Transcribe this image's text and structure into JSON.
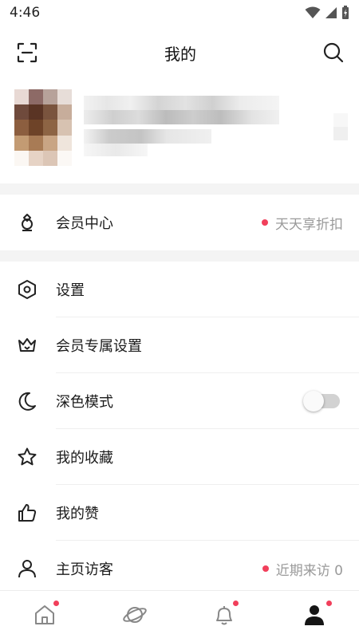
{
  "status_bar": {
    "time": "4:46"
  },
  "header": {
    "title": "我的"
  },
  "member_row": {
    "label": "会员中心",
    "badge_text": "天天享折扣"
  },
  "menu": [
    {
      "icon": "hexagon-settings-icon",
      "label": "设置"
    },
    {
      "icon": "crown-icon",
      "label": "会员专属设置"
    },
    {
      "icon": "moon-icon",
      "label": "深色模式",
      "toggle_on": false
    },
    {
      "icon": "star-icon",
      "label": "我的收藏"
    },
    {
      "icon": "thumbs-up-icon",
      "label": "我的赞"
    },
    {
      "icon": "person-icon",
      "label": "主页访客",
      "badge_text": "近期来访 0"
    }
  ],
  "bottom_nav": [
    {
      "icon": "home-icon",
      "has_dot": true
    },
    {
      "icon": "planet-icon",
      "has_dot": false
    },
    {
      "icon": "bell-icon",
      "has_dot": true
    },
    {
      "icon": "profile-icon",
      "has_dot": true,
      "active": true
    }
  ],
  "colors": {
    "accent_dot": "#f13f5b",
    "band": "#f4f4f4",
    "secondary_text": "#9a9a9a"
  }
}
